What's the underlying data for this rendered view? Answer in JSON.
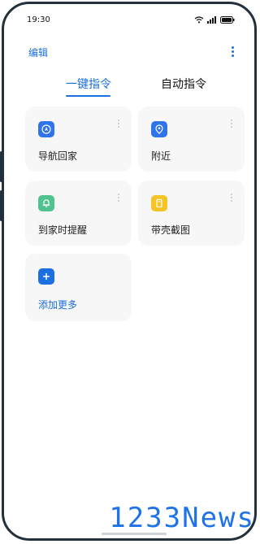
{
  "status_bar": {
    "time": "19:30"
  },
  "header": {
    "edit_label": "编辑"
  },
  "tabs": [
    {
      "label": "一键指令",
      "active": true
    },
    {
      "label": "自动指令",
      "active": false
    }
  ],
  "cards": [
    {
      "label": "导航回家",
      "icon": "navigation-icon",
      "color": "#2f74ea"
    },
    {
      "label": "附近",
      "icon": "location-pin-icon",
      "color": "#2f74ea"
    },
    {
      "label": "到家时提醒",
      "icon": "bell-icon",
      "color": "#4fc28f"
    },
    {
      "label": "带壳截图",
      "icon": "screenshot-icon",
      "color": "#f6c324"
    },
    {
      "label": "添加更多",
      "icon": "plus-icon",
      "color": "#1b6fe0"
    }
  ],
  "watermark": "1233News"
}
